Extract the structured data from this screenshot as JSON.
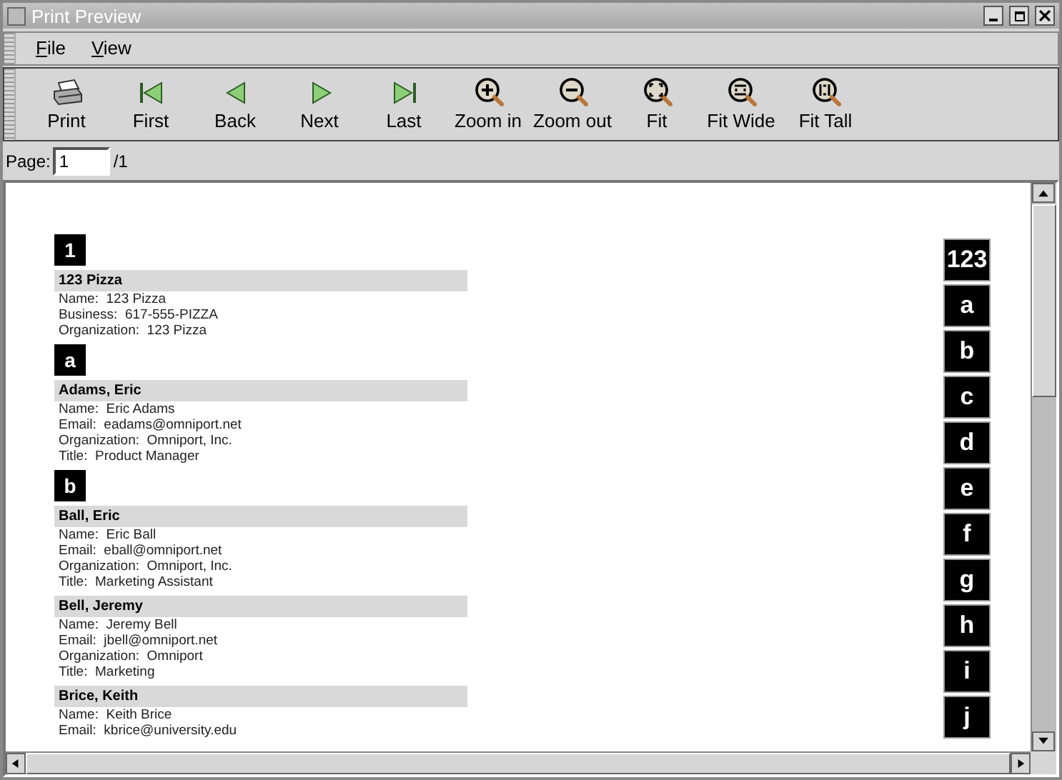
{
  "window": {
    "title": "Print Preview"
  },
  "menu": [
    {
      "label": "File"
    },
    {
      "label": "View"
    }
  ],
  "toolbar": [
    {
      "label": "Print",
      "kind": "print"
    },
    {
      "label": "First",
      "kind": "first"
    },
    {
      "label": "Back",
      "kind": "back"
    },
    {
      "label": "Next",
      "kind": "next"
    },
    {
      "label": "Last",
      "kind": "last"
    },
    {
      "label": "Zoom in",
      "kind": "zoom-in"
    },
    {
      "label": "Zoom out",
      "kind": "zoom-out"
    },
    {
      "label": "Fit",
      "kind": "fit"
    },
    {
      "label": "Fit Wide",
      "kind": "fit-wide"
    },
    {
      "label": "Fit Tall",
      "kind": "fit-tall"
    }
  ],
  "page": {
    "label": "Page:",
    "value": "1",
    "total": "/1"
  },
  "sections": [
    {
      "letter": "1",
      "contacts": [
        {
          "name": "123 Pizza",
          "lines": [
            "Name:  123 Pizza",
            "Business:  617-555-PIZZA",
            "Organization:  123 Pizza"
          ]
        }
      ]
    },
    {
      "letter": "a",
      "contacts": [
        {
          "name": "Adams, Eric",
          "lines": [
            "Name:  Eric Adams",
            "Email:  eadams@omniport.net",
            "Organization:  Omniport, Inc.",
            "Title:  Product Manager"
          ]
        }
      ]
    },
    {
      "letter": "b",
      "contacts": [
        {
          "name": "Ball, Eric",
          "lines": [
            "Name:  Eric Ball",
            "Email:  eball@omniport.net",
            "Organization:  Omniport, Inc.",
            "Title:  Marketing Assistant"
          ]
        },
        {
          "name": "Bell, Jeremy",
          "lines": [
            "Name:  Jeremy Bell",
            "Email:  jbell@omniport.net",
            "Organization:  Omniport",
            "Title:  Marketing"
          ]
        },
        {
          "name": "Brice, Keith",
          "lines": [
            "Name:  Keith Brice",
            "Email:  kbrice@university.edu"
          ]
        }
      ]
    }
  ],
  "index_tabs": [
    "123",
    "a",
    "b",
    "c",
    "d",
    "e",
    "f",
    "g",
    "h",
    "i",
    "j"
  ]
}
